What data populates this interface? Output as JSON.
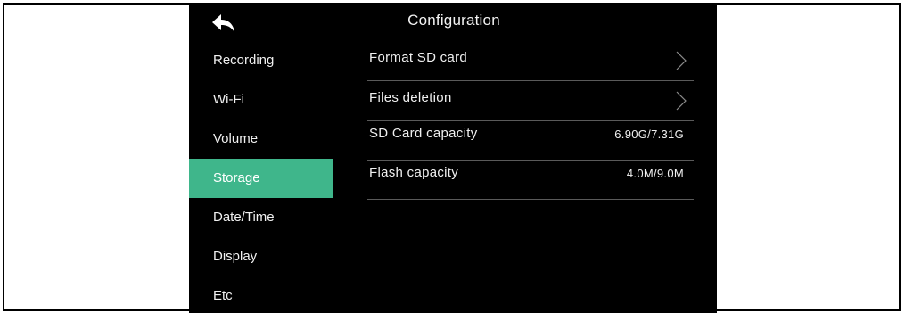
{
  "header": {
    "back_icon": "back-arrow-icon",
    "title": "Configuration"
  },
  "sidebar": {
    "items": [
      {
        "label": "Recording"
      },
      {
        "label": "Wi-Fi"
      },
      {
        "label": "Volume"
      },
      {
        "label": "Storage",
        "active": true
      },
      {
        "label": "Date/Time"
      },
      {
        "label": "Display"
      },
      {
        "label": "Etc"
      }
    ]
  },
  "storage": {
    "format_sd_label": "Format SD card",
    "files_deletion_label": "Files deletion",
    "sd_capacity_label": "SD Card capacity",
    "sd_capacity_value": "6.90G/7.31G",
    "flash_capacity_label": "Flash capacity",
    "flash_capacity_value": "4.0M/9.0M"
  },
  "colors": {
    "accent": "#3fb68b",
    "background": "#000000",
    "divider": "#5a5a5a"
  }
}
